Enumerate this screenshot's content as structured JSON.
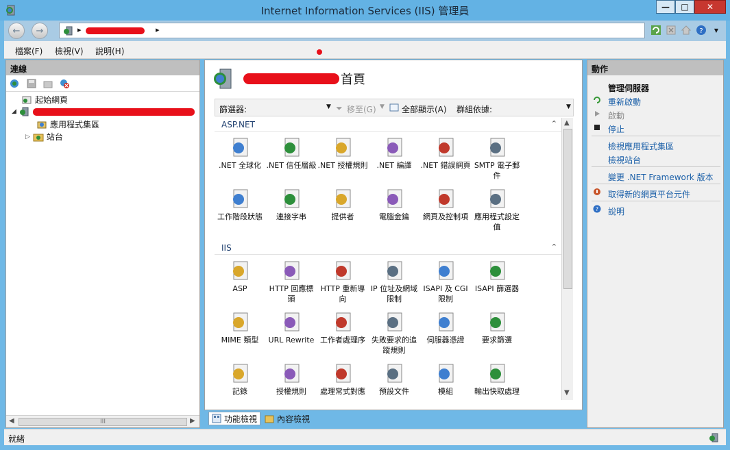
{
  "window": {
    "title": "Internet Information Services (IIS) 管理員",
    "minimize": "—",
    "maximize": "□",
    "close": "✕"
  },
  "address": {
    "back": "←",
    "forward": "→",
    "separator": "▸"
  },
  "menu": {
    "file": "檔案(F)",
    "view": "檢視(V)",
    "help": "說明(H)"
  },
  "connections": {
    "header": "連線",
    "tree": {
      "start_page": "起始網頁",
      "app_pools": "應用程式集區",
      "sites": "站台"
    },
    "scroll_left": "◀",
    "scroll_right": "▶",
    "scroll_grip": "III"
  },
  "center": {
    "home_suffix": "首頁",
    "filter": {
      "label": "篩選器:",
      "go": "移至(G)",
      "show_all": "全部顯示(A)",
      "group_by": "群組依據:"
    },
    "groups": [
      {
        "title": "ASP.NET",
        "items": [
          ".NET 全球化",
          ".NET 信任層級",
          ".NET 授權規則",
          ".NET 編譯",
          ".NET 錯誤網頁",
          "SMTP 電子郵件",
          "工作階段狀態",
          "連接字串",
          "提供者",
          "電腦金鑰",
          "網頁及控制項",
          "應用程式設定值"
        ]
      },
      {
        "title": "IIS",
        "items": [
          "ASP",
          "HTTP 回應標頭",
          "HTTP 重新導向",
          "IP 位址及網域限制",
          "ISAPI 及 CGI 限制",
          "ISAPI 篩選器",
          "MIME 類型",
          "URL Rewrite",
          "工作者處理序",
          "失敗要求的追蹤規則",
          "伺服器憑證",
          "要求篩選",
          "記錄",
          "授權規則",
          "處理常式對應",
          "預設文件",
          "模組",
          "輸出快取處理"
        ]
      }
    ],
    "collapse": "⌃",
    "scroll_up": "▲",
    "scroll_down": "▼"
  },
  "tabs": {
    "features": "功能檢視",
    "content": "內容檢視"
  },
  "actions": {
    "header": "動作",
    "manage_server": "管理伺服器",
    "restart": "重新啟動",
    "start": "啟動",
    "stop": "停止",
    "view_app_pools": "檢視應用程式集區",
    "view_sites": "檢視站台",
    "change_net": "變更 .NET Framework 版本",
    "get_new_components": "取得新的網頁平台元件",
    "help": "說明"
  },
  "status": {
    "text": "就緒"
  },
  "colors": {
    "title_bar": "#63b2e4",
    "redaction": "#e8101a",
    "link": "#1a5fa8"
  }
}
